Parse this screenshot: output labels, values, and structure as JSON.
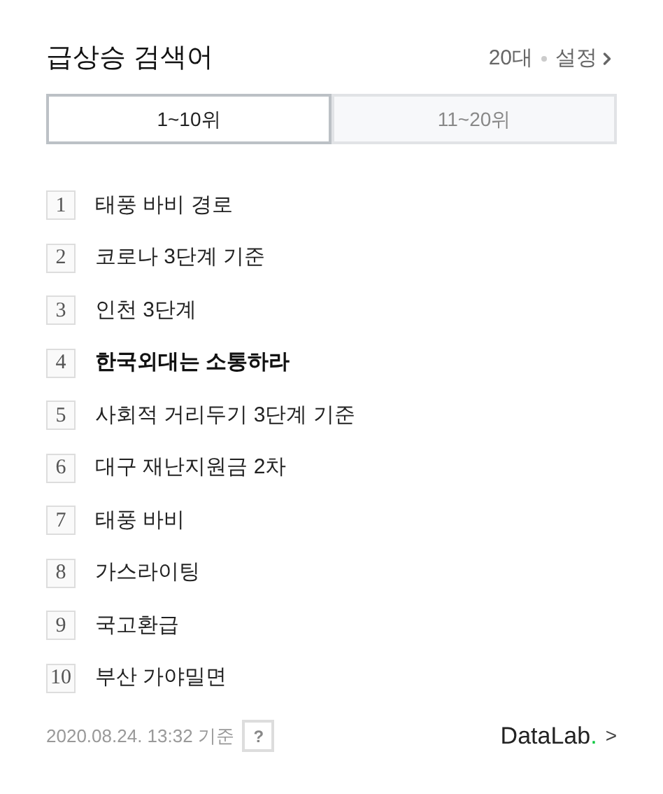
{
  "header": {
    "title": "급상승 검색어",
    "age": "20대",
    "settings": "설정"
  },
  "tabs": [
    {
      "label": "1~10위",
      "selected": true
    },
    {
      "label": "11~20위",
      "selected": false
    }
  ],
  "items": [
    {
      "rank": "1",
      "keyword": "태풍 바비 경로",
      "highlighted": false
    },
    {
      "rank": "2",
      "keyword": "코로나 3단계 기준",
      "highlighted": false
    },
    {
      "rank": "3",
      "keyword": "인천 3단계",
      "highlighted": false
    },
    {
      "rank": "4",
      "keyword": "한국외대는 소통하라",
      "highlighted": true
    },
    {
      "rank": "5",
      "keyword": "사회적 거리두기 3단계 기준",
      "highlighted": false
    },
    {
      "rank": "6",
      "keyword": "대구 재난지원금 2차",
      "highlighted": false
    },
    {
      "rank": "7",
      "keyword": "태풍 바비",
      "highlighted": false
    },
    {
      "rank": "8",
      "keyword": "가스라이팅",
      "highlighted": false
    },
    {
      "rank": "9",
      "keyword": "국고환급",
      "highlighted": false
    },
    {
      "rank": "10",
      "keyword": "부산 가야밀면",
      "highlighted": false
    }
  ],
  "footer": {
    "timestamp": "2020.08.24. 13:32 기준",
    "help": "?",
    "logo": "DataLab",
    "logo_dot": ".",
    "link_arrow": ">"
  }
}
